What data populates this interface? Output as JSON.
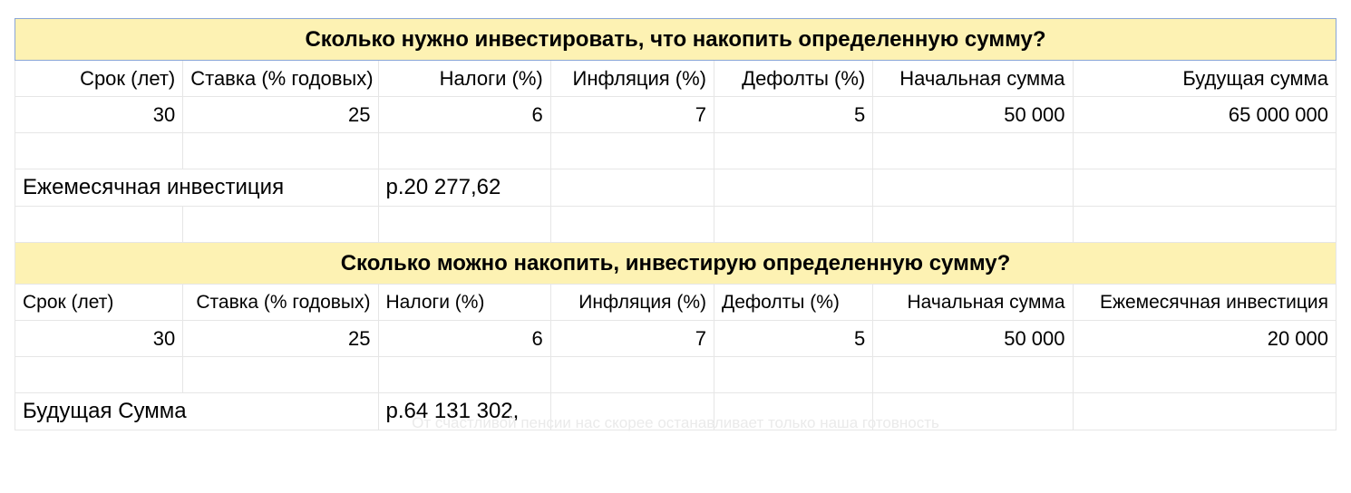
{
  "block1": {
    "title": "Сколько нужно инвестировать, что накопить определенную сумму?",
    "headers": {
      "term": "Срок (лет)",
      "rate": "Ставка (% годовых)",
      "taxes": "Налоги (%)",
      "inflation": "Инфляция (%)",
      "defaults": "Дефолты (%)",
      "initial": "Начальная сумма",
      "future": "Будущая сумма"
    },
    "values": {
      "term": "30",
      "rate": "25",
      "taxes": "6",
      "inflation": "7",
      "defaults": "5",
      "initial": "50 000",
      "future": "65 000 000"
    },
    "resultLabel": "Ежемесячная инвестиция",
    "resultValue": "р.20 277,62"
  },
  "block2": {
    "title": "Сколько можно накопить, инвестирую определенную сумму?",
    "headers": {
      "term": "Срок (лет)",
      "rate": "Ставка (% годовых)",
      "taxes": "Налоги (%)",
      "inflation": "Инфляция (%)",
      "defaults": "Дефолты (%)",
      "initial": "Начальная сумма",
      "monthly": "Ежемесячная инвестиция"
    },
    "values": {
      "term": "30",
      "rate": "25",
      "taxes": "6",
      "inflation": "7",
      "defaults": "5",
      "initial": "50 000",
      "monthly": "20 000"
    },
    "resultLabel": "Будущая Сумма",
    "resultValue": "р.64 131 302,"
  },
  "watermark": "От счастливой пенсии нас скорее останавливает только наша готовность"
}
